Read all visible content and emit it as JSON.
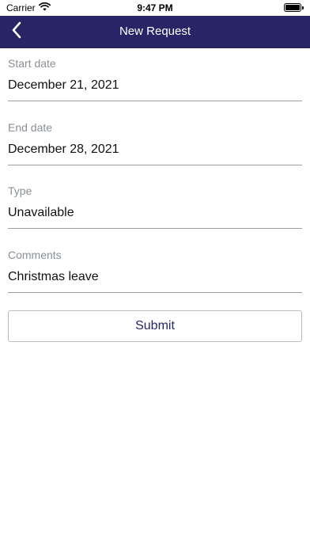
{
  "status_bar": {
    "carrier": "Carrier",
    "time": "9:47 PM",
    "battery_level": 1.0
  },
  "nav": {
    "title": "New Request",
    "back_icon": "chevron-left-icon"
  },
  "form": {
    "fields": [
      {
        "label": "Start date",
        "value": "December 21, 2021"
      },
      {
        "label": "End date",
        "value": "December 28, 2021"
      },
      {
        "label": "Type",
        "value": "Unavailable"
      },
      {
        "label": "Comments",
        "value": "Christmas leave"
      }
    ],
    "submit_label": "Submit"
  },
  "colors": {
    "nav_background": "#272566",
    "label_gray": "#8a8f98",
    "accent": "#272566"
  }
}
